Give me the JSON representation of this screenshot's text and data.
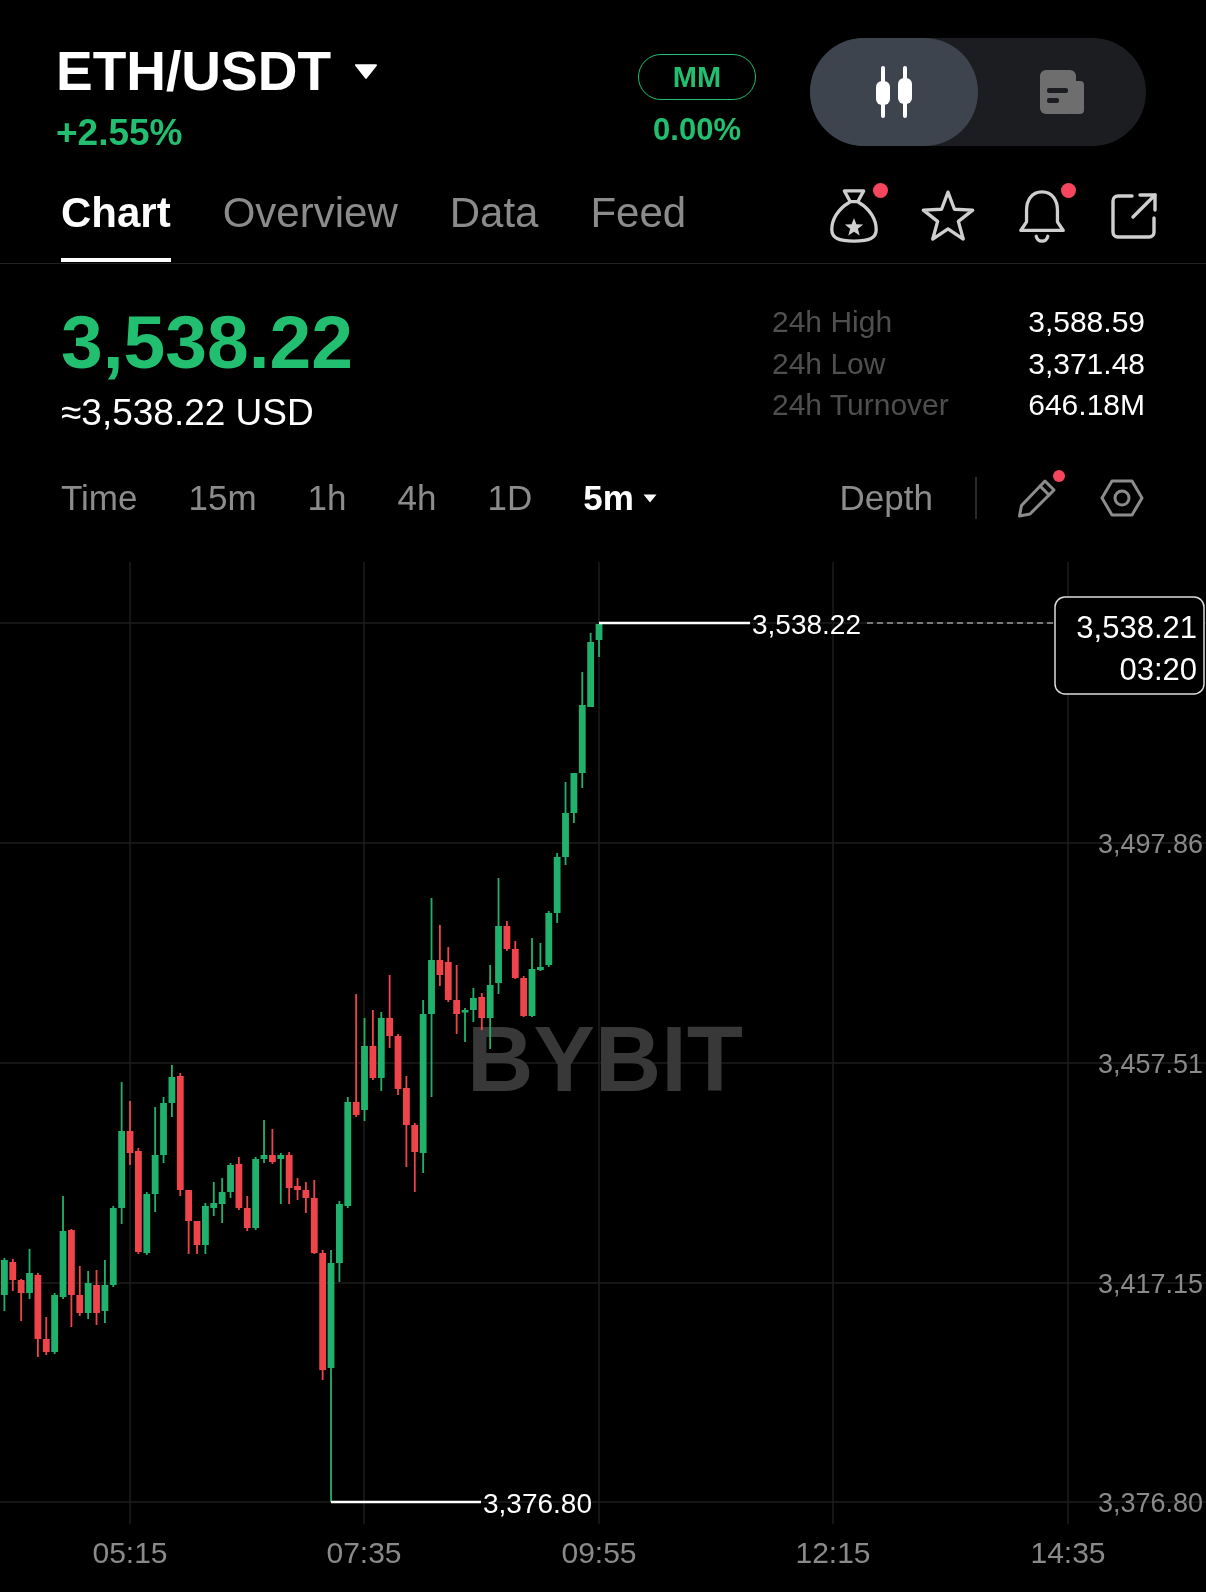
{
  "header": {
    "pair": "ETH/USDT",
    "change": "+2.55%",
    "mm": {
      "label": "MM",
      "value": "0.00%"
    },
    "view_toggle": [
      {
        "selected": true
      },
      {
        "selected": false
      }
    ]
  },
  "tabs": [
    {
      "label": "Chart",
      "selected": true
    },
    {
      "label": "Overview",
      "selected": false
    },
    {
      "label": "Data",
      "selected": false
    },
    {
      "label": "Feed",
      "selected": false
    }
  ],
  "action_icons": [
    {
      "badge": true
    },
    {
      "badge": false
    },
    {
      "badge": true
    },
    {
      "badge": false
    }
  ],
  "ticker": {
    "last_price": "3,538.22",
    "fiat_price": "≈3,538.22 USD",
    "stats": [
      {
        "label": "24h High",
        "value": "3,588.59"
      },
      {
        "label": "24h Low",
        "value": "3,371.48"
      },
      {
        "label": "24h Turnover",
        "value": "646.18M"
      }
    ]
  },
  "timeframes": [
    {
      "label": "Time",
      "selected": false,
      "dropdown": false
    },
    {
      "label": "15m",
      "selected": false,
      "dropdown": false
    },
    {
      "label": "1h",
      "selected": false,
      "dropdown": false
    },
    {
      "label": "4h",
      "selected": false,
      "dropdown": false
    },
    {
      "label": "1D",
      "selected": false,
      "dropdown": false
    },
    {
      "label": "5m",
      "selected": true,
      "dropdown": true
    }
  ],
  "chart_tools": {
    "depth": "Depth",
    "draw_tool_badge": true
  },
  "chart": {
    "watermark": "BYBIT",
    "last_price_label": "3,538.22",
    "price_tag": {
      "price": "3,538.21",
      "countdown": "03:20"
    },
    "low_label": "3,376.80",
    "y_axis": [
      "3,497.86",
      "3,457.51",
      "3,417.15",
      "3,376.80"
    ],
    "x_axis": [
      "05:15",
      "07:35",
      "09:55",
      "12:15",
      "14:35"
    ]
  }
}
